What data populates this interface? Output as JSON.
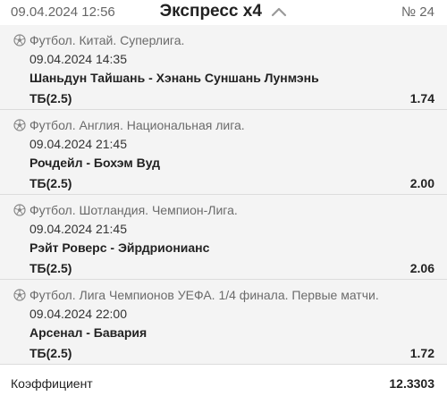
{
  "header": {
    "date": "09.04.2024 12:56",
    "title": "Экспресс x4",
    "number": "№ 24",
    "toggle_icon": "chevron-up-icon"
  },
  "bets": [
    {
      "league": "Футбол. Китай. Суперлига.",
      "time": "09.04.2024 14:35",
      "teams": "Шаньдун Тайшань - Хэнань Суншань Лунмэнь",
      "market": "ТБ(2.5)",
      "odds": "1.74",
      "icon": "soccer-ball-icon"
    },
    {
      "league": "Футбол. Англия. Национальная лига.",
      "time": "09.04.2024 21:45",
      "teams": "Рочдейл - Бохэм Вуд",
      "market": "ТБ(2.5)",
      "odds": "2.00",
      "icon": "soccer-ball-icon"
    },
    {
      "league": "Футбол. Шотландия. Чемпион-Лига.",
      "time": "09.04.2024 21:45",
      "teams": "Рэйт Роверс - Эйрдрионианс",
      "market": "ТБ(2.5)",
      "odds": "2.06",
      "icon": "soccer-ball-icon"
    },
    {
      "league": "Футбол. Лига Чемпионов УЕФА. 1/4 финала. Первые матчи.",
      "time": "09.04.2024 22:00",
      "teams": "Арсенал - Бавария",
      "market": "ТБ(2.5)",
      "odds": "1.72",
      "icon": "soccer-ball-icon"
    }
  ],
  "footer": {
    "label": "Коэффициент",
    "value": "12.3303"
  }
}
